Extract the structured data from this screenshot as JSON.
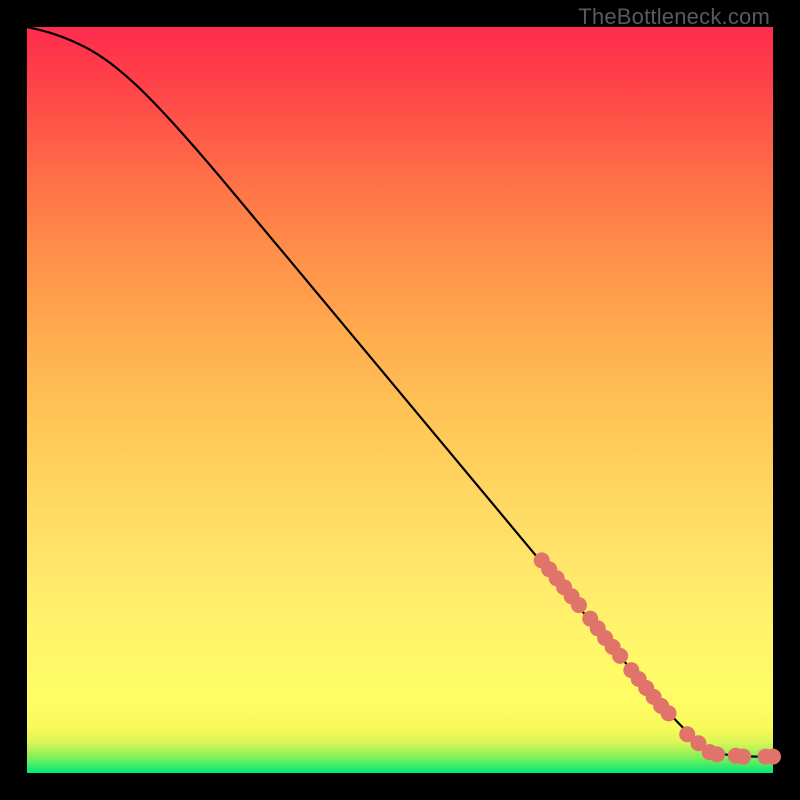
{
  "watermark": "TheBottleneck.com",
  "chart_data": {
    "type": "line",
    "title": "",
    "xlabel": "",
    "ylabel": "",
    "xlim": [
      0,
      100
    ],
    "ylim": [
      0,
      100
    ],
    "curve": [
      {
        "x": 0,
        "y": 100
      },
      {
        "x": 3,
        "y": 99.3
      },
      {
        "x": 6,
        "y": 98.2
      },
      {
        "x": 9,
        "y": 96.7
      },
      {
        "x": 12,
        "y": 94.6
      },
      {
        "x": 16,
        "y": 91.0
      },
      {
        "x": 22,
        "y": 84.5
      },
      {
        "x": 30,
        "y": 75.0
      },
      {
        "x": 40,
        "y": 63.0
      },
      {
        "x": 50,
        "y": 51.0
      },
      {
        "x": 60,
        "y": 39.0
      },
      {
        "x": 70,
        "y": 27.0
      },
      {
        "x": 80,
        "y": 15.0
      },
      {
        "x": 86,
        "y": 8.0
      },
      {
        "x": 90,
        "y": 4.0
      },
      {
        "x": 93,
        "y": 2.5
      },
      {
        "x": 96,
        "y": 2.2
      },
      {
        "x": 100,
        "y": 2.2
      }
    ],
    "markers": [
      {
        "x": 69,
        "y": 28.5
      },
      {
        "x": 70,
        "y": 27.3
      },
      {
        "x": 71,
        "y": 26.1
      },
      {
        "x": 72,
        "y": 24.9
      },
      {
        "x": 73,
        "y": 23.7
      },
      {
        "x": 74,
        "y": 22.5
      },
      {
        "x": 75.5,
        "y": 20.7
      },
      {
        "x": 76.5,
        "y": 19.4
      },
      {
        "x": 77.5,
        "y": 18.1
      },
      {
        "x": 78.5,
        "y": 16.9
      },
      {
        "x": 79.5,
        "y": 15.7
      },
      {
        "x": 81,
        "y": 13.8
      },
      {
        "x": 82,
        "y": 12.6
      },
      {
        "x": 83,
        "y": 11.4
      },
      {
        "x": 84,
        "y": 10.2
      },
      {
        "x": 85,
        "y": 9.0
      },
      {
        "x": 86,
        "y": 8.0
      },
      {
        "x": 88.5,
        "y": 5.2
      },
      {
        "x": 90,
        "y": 4.0
      },
      {
        "x": 91.5,
        "y": 2.8
      },
      {
        "x": 92.5,
        "y": 2.5
      },
      {
        "x": 95,
        "y": 2.3
      },
      {
        "x": 96,
        "y": 2.2
      },
      {
        "x": 99,
        "y": 2.2
      },
      {
        "x": 100,
        "y": 2.2
      }
    ],
    "marker_color": "#e0746b",
    "line_color": "#000000",
    "gradient_stops": [
      {
        "pos": 0.0,
        "color": "#00e87a"
      },
      {
        "pos": 0.06,
        "color": "#f8f95a"
      },
      {
        "pos": 0.5,
        "color": "#ffb850"
      },
      {
        "pos": 1.0,
        "color": "#ff2c4e"
      }
    ]
  }
}
